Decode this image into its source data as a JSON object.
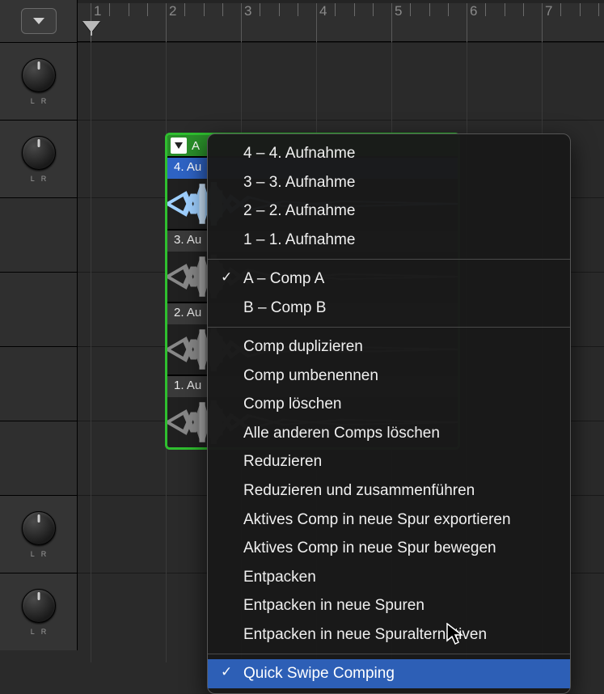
{
  "ruler": {
    "bar_labels": [
      "1",
      "2",
      "3",
      "4",
      "5",
      "6",
      "7"
    ]
  },
  "pan": {
    "left": "L",
    "right": "R"
  },
  "region": {
    "header_label": "A",
    "takes": [
      {
        "label": "4. Au",
        "selected": true
      },
      {
        "label": "3. Au",
        "selected": false
      },
      {
        "label": "2. Au",
        "selected": false
      },
      {
        "label": "1. Au",
        "selected": false
      }
    ]
  },
  "menu": {
    "section_takes": [
      "4 – 4. Aufnahme",
      "3 – 3. Aufnahme",
      "2 – 2. Aufnahme",
      "1 – 1. Aufnahme"
    ],
    "section_comps": [
      {
        "label": "A – Comp A",
        "checked": true
      },
      {
        "label": "B – Comp B",
        "checked": false
      }
    ],
    "section_actions": [
      "Comp duplizieren",
      "Comp umbenennen",
      "Comp löschen",
      "Alle anderen Comps löschen",
      "Reduzieren",
      "Reduzieren und zusammenführen",
      "Aktives Comp in neue Spur exportieren",
      "Aktives Comp in neue Spur bewegen",
      "Entpacken",
      "Entpacken in neue Spuren",
      "Entpacken in neue Spuralternativen"
    ],
    "section_toggle": {
      "label": "Quick Swipe Comping",
      "checked": true,
      "highlighted": true
    }
  }
}
